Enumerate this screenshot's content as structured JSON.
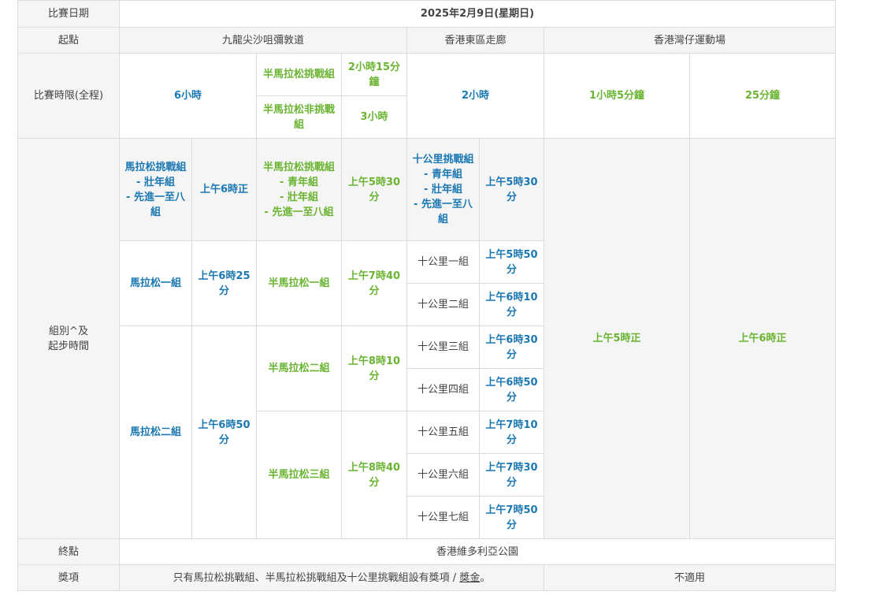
{
  "rows": {
    "date": {
      "label": "比賽日期",
      "value": "2025年2月9日(星期日)"
    },
    "start": {
      "label": "起點",
      "kowloon": "九龍尖沙咀彌敦道",
      "east_corridor": "香港東區走廊",
      "so_kon_po": "香港灣仔運動場"
    },
    "time_limit": {
      "label": "比賽時限(全程)",
      "marathon": "6小時",
      "hm_challenge_name": "半馬拉松挑戰組",
      "hm_challenge_time": "2小時15分鐘",
      "hm_non_challenge_name": "半馬拉松非挑戰組",
      "hm_non_challenge_time": "3小時",
      "ten_km": "2小時",
      "wheelchair_hm": "1小時5分鐘",
      "wheelchair_10k": "25分鐘"
    },
    "groups": {
      "label": "組別^及\n起步時間",
      "marathon_challenge": {
        "name": "馬拉松挑戰組\n- 壯年組\n- 先進一至八組",
        "time": "上午6時正"
      },
      "marathon_1": {
        "name": "馬拉松一組",
        "time": "上午6時25分"
      },
      "marathon_2": {
        "name": "馬拉松二組",
        "time": "上午6時50分"
      },
      "hm_challenge": {
        "name": "半馬拉松挑戰組\n- 青年組\n- 壯年組\n- 先進一至八組",
        "time": "上午5時30分"
      },
      "hm_1": {
        "name": "半馬拉松一組",
        "time": "上午7時40分"
      },
      "hm_2": {
        "name": "半馬拉松二組",
        "time": "上午8時10分"
      },
      "hm_3": {
        "name": "半馬拉松三組",
        "time": "上午8時40分"
      },
      "tk_challenge": {
        "name": "十公里挑戰組\n- 青年組\n- 壯年組\n- 先進一至八組",
        "time": "上午5時30分"
      },
      "tk_1": {
        "name": "十公里一組",
        "time": "上午5時50分"
      },
      "tk_2": {
        "name": "十公里二組",
        "time": "上午6時10分"
      },
      "tk_3": {
        "name": "十公里三組",
        "time": "上午6時30分"
      },
      "tk_4": {
        "name": "十公里四組",
        "time": "上午6時50分"
      },
      "tk_5": {
        "name": "十公里五組",
        "time": "上午7時10分"
      },
      "tk_6": {
        "name": "十公里六組",
        "time": "上午7時30分"
      },
      "tk_7": {
        "name": "十公里七組",
        "time": "上午7時50分"
      },
      "wheelchair_hm_time": "上午5時正",
      "wheelchair_10k_time": "上午6時正"
    },
    "finish": {
      "label": "終點",
      "value": "香港維多利亞公園"
    },
    "prize": {
      "label": "獎項",
      "text_before": "只有馬拉松挑戰組、半馬拉松挑戰組及十公里挑戰組設有獎項 / ",
      "link": "獎金",
      "text_after": "。",
      "wheelchair": "不適用"
    }
  },
  "colors": {
    "blue": "#1b78b3",
    "green": "#6ab432",
    "grey_bg": "#f5f5f5",
    "border": "#dcdcdc"
  }
}
